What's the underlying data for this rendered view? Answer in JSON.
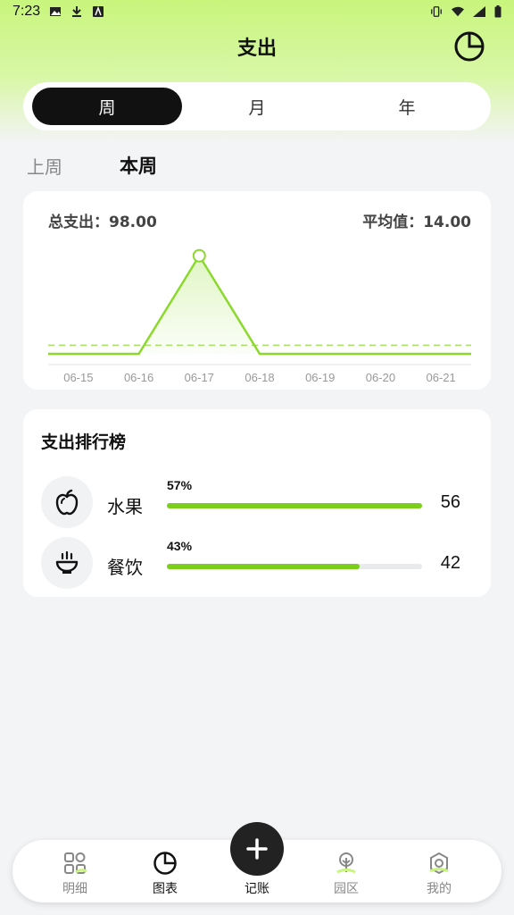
{
  "status_bar": {
    "time": "7:23"
  },
  "header": {
    "title": "支出"
  },
  "segment": {
    "tabs": [
      "周",
      "月",
      "年"
    ],
    "active": 0
  },
  "period": {
    "prev": "上周",
    "current": "本周"
  },
  "summary": {
    "total": "总支出：98.00",
    "average": "平均值：14.00"
  },
  "chart_data": {
    "type": "area",
    "categories": [
      "06-15",
      "06-16",
      "06-17",
      "06-18",
      "06-19",
      "06-20",
      "06-21"
    ],
    "values": [
      0,
      0,
      98,
      0,
      0,
      0,
      0
    ],
    "average": 14,
    "highlight_index": 2,
    "ylim": [
      0,
      100
    ],
    "line_color": "#8ad92b"
  },
  "ranking": {
    "title": "支出排行榜",
    "items": [
      {
        "name": "水果",
        "percent": "57%",
        "value": "56",
        "ratio": 0.57,
        "icon": "apple-icon"
      },
      {
        "name": "餐饮",
        "percent": "43%",
        "value": "42",
        "ratio": 0.43,
        "icon": "bowl-icon"
      }
    ]
  },
  "nav": {
    "items": [
      {
        "label": "明细",
        "icon": "grid-icon"
      },
      {
        "label": "图表",
        "icon": "pie-chart-icon"
      },
      {
        "label": "记账",
        "icon": "plus-icon"
      },
      {
        "label": "园区",
        "icon": "tree-icon"
      },
      {
        "label": "我的",
        "icon": "settings-icon"
      }
    ]
  },
  "colors": {
    "accent": "#7bcf1b",
    "header_gradient": "#c8f57c"
  }
}
